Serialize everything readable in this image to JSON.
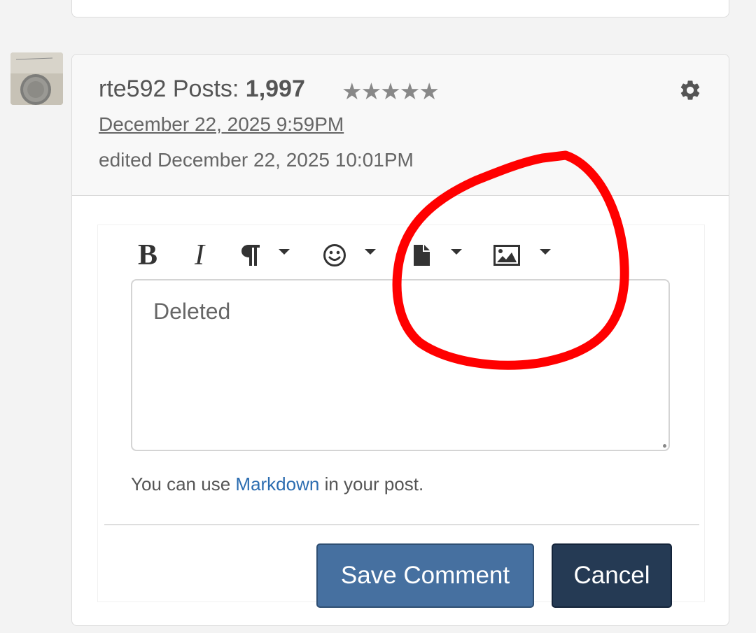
{
  "post": {
    "username": "rte592",
    "posts_label": "Posts:",
    "posts_count": "1,997",
    "rating_stars": "★★★★★",
    "date": "December 22, 2025 9:59PM",
    "edited": "edited December 22, 2025 10:01PM"
  },
  "editor": {
    "toolbar": {
      "bold_label": "B",
      "italic_label": "I",
      "buttons": [
        "bold",
        "italic",
        "paragraph-format",
        "emoji",
        "attach-file",
        "insert-image"
      ]
    },
    "text_value": "Deleted",
    "hint_prefix": "You can use",
    "hint_link": "Markdown",
    "hint_suffix": "in your post."
  },
  "actions": {
    "save_label": "Save Comment",
    "cancel_label": "Cancel"
  },
  "colors": {
    "page_bg": "#f3f3f3",
    "header_bg": "#f8f8f8",
    "link": "#2b6cb0",
    "save_button": "#4670a0",
    "cancel_button": "#253a54",
    "annotation": "#ff0000"
  },
  "icons": [
    "gear-icon",
    "paragraph-icon",
    "emoji-icon",
    "file-icon",
    "image-icon",
    "chevron-down-icon"
  ]
}
